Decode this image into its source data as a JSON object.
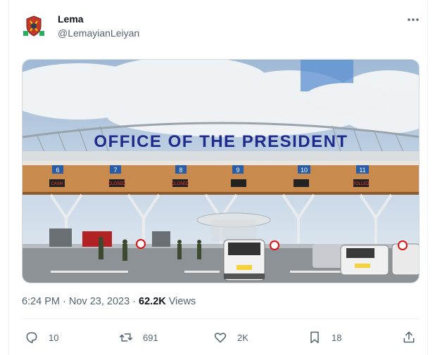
{
  "author": {
    "display_name": "Lema",
    "handle": "@LemayianLeiyan",
    "avatar_icon": "avatar-emblem-icon"
  },
  "media": {
    "sign_text": "OFFICE OF THE PRESIDENT",
    "lane_numbers": [
      "6",
      "7",
      "8",
      "9",
      "10",
      "11"
    ],
    "lane_status": [
      "CASH",
      "CLOSED",
      "CLOSED",
      "",
      "",
      "TOLLED"
    ]
  },
  "meta": {
    "timestamp": "6:24 PM · Nov 23, 2023 · ",
    "views_count": "62.2K",
    "views_label": " Views"
  },
  "actions": {
    "reply_count": "10",
    "repost_count": "691",
    "like_count": "2K",
    "bookmark_count": "18"
  },
  "colors": {
    "sign_text": "#1f2b8c",
    "sky": "#b9d0e6",
    "canopy": "#c98a4e",
    "text_secondary": "#536471"
  }
}
